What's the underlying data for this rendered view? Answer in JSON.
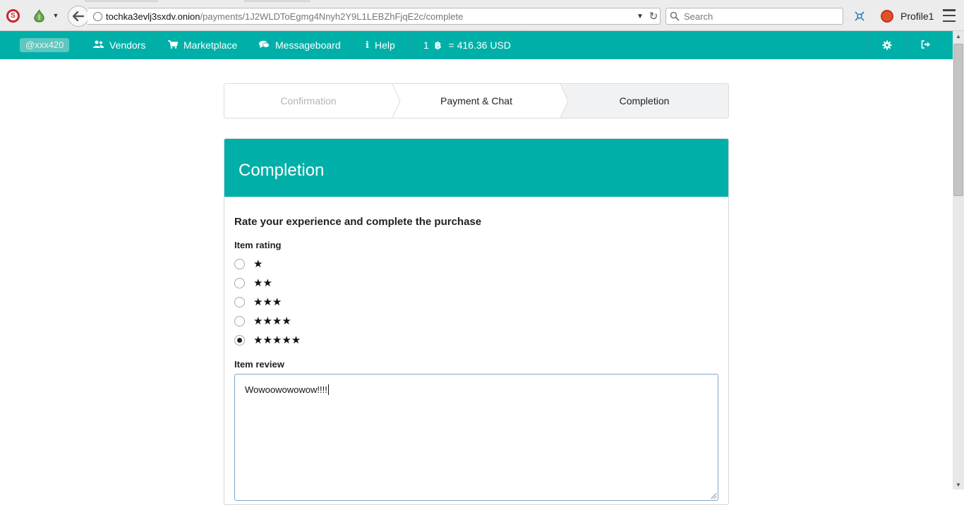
{
  "browser": {
    "url_host": "tochka3evlj3sxdv.onion",
    "url_path": "/payments/1J2WLDToEgmg4Nnyh2Y9L1LEBZhFjqE2c/complete",
    "search_placeholder": "Search",
    "profile_label": "Profile1",
    "icons": [
      "noscript-icon",
      "onion-icon",
      "back-arrow-icon",
      "globe-icon",
      "reload-icon",
      "search-icon",
      "network-icon",
      "profile-icon",
      "hamburger-menu-icon"
    ]
  },
  "navbar": {
    "user_badge": "@xxx420",
    "items": [
      {
        "icon": "users-icon",
        "label": "Vendors"
      },
      {
        "icon": "cart-icon",
        "label": "Marketplace"
      },
      {
        "icon": "comments-icon",
        "label": "Messageboard"
      },
      {
        "icon": "info-icon",
        "label": "Help"
      }
    ],
    "rate_amount": "1",
    "rate_symbol": "฿",
    "rate_value": "= 416.36 USD",
    "accent_color": "#00b0a8"
  },
  "steps": [
    {
      "label": "Confirmation",
      "state": "done"
    },
    {
      "label": "Payment & Chat",
      "state": "current"
    },
    {
      "label": "Completion",
      "state": "active"
    }
  ],
  "card": {
    "title": "Completion",
    "subtitle": "Rate your experience and complete the purchase",
    "rating_label": "Item rating",
    "ratings": [
      {
        "stars": "★",
        "checked": false
      },
      {
        "stars": "★★",
        "checked": false
      },
      {
        "stars": "★★★",
        "checked": false
      },
      {
        "stars": "★★★★",
        "checked": false
      },
      {
        "stars": "★★★★★",
        "checked": true
      }
    ],
    "review_label": "Item review",
    "review_value": "Wowoowowowow!!!!"
  }
}
